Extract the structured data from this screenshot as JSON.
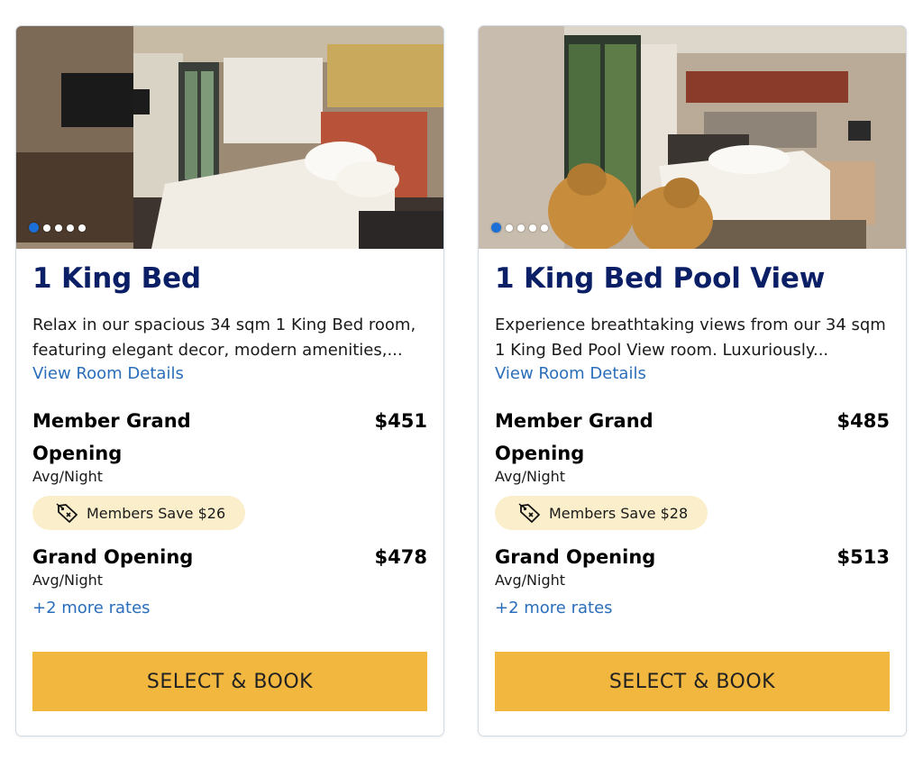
{
  "rooms": [
    {
      "title": "1 King Bed",
      "description": "Relax in our spacious 34 sqm 1 King Bed room, featuring elegant decor, modern amenities,...",
      "details_link": "View Room Details",
      "rates": [
        {
          "name": "Member Grand Opening",
          "price": "$451",
          "per": "Avg/Night",
          "badge": "Members Save $26"
        },
        {
          "name": "Grand Opening",
          "price": "$478",
          "per": "Avg/Night"
        }
      ],
      "more_rates": "+2 more rates",
      "cta": "SELECT & BOOK",
      "carousel": {
        "total": 5,
        "active_index": 0
      }
    },
    {
      "title": "1 King Bed Pool View",
      "description": "Experience breathtaking views from our 34 sqm 1 King Bed Pool View room. Luxuriously...",
      "details_link": "View Room Details",
      "rates": [
        {
          "name": "Member Grand Opening",
          "price": "$485",
          "per": "Avg/Night",
          "badge": "Members Save $28"
        },
        {
          "name": "Grand Opening",
          "price": "$513",
          "per": "Avg/Night"
        }
      ],
      "more_rates": "+2 more rates",
      "cta": "SELECT & BOOK",
      "carousel": {
        "total": 5,
        "active_index": 0
      }
    }
  ],
  "colors": {
    "title": "#0b1f66",
    "link": "#2a6ebb",
    "cta_bg": "#f2b73f",
    "badge_bg": "#fbeecb",
    "active_dot": "#1c6fd6"
  },
  "icons": {
    "badge_icon": "discount-tag-icon"
  }
}
